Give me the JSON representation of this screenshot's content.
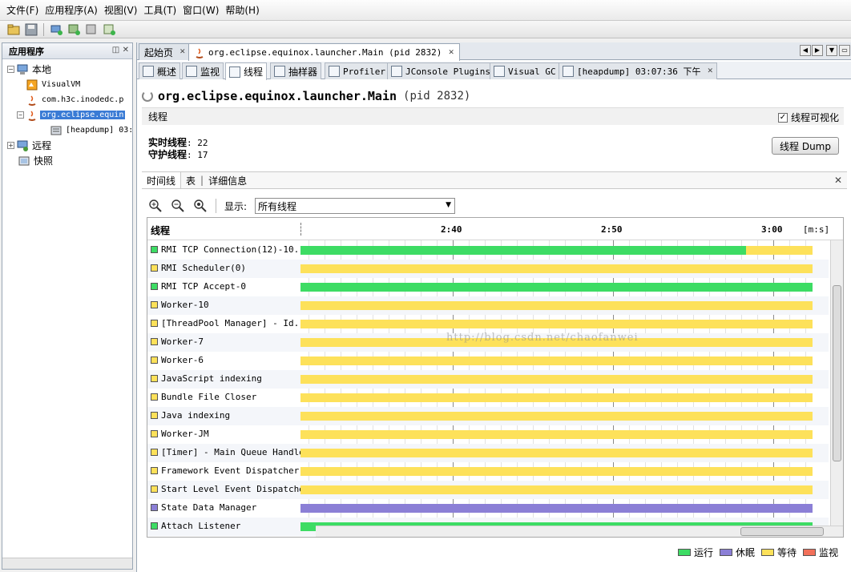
{
  "menu": [
    "文件(F)",
    "应用程序(A)",
    "视图(V)",
    "工具(T)",
    "窗口(W)",
    "帮助(H)"
  ],
  "toolbar": {
    "icons": [
      "open-icon",
      "save-icon",
      "add-host-icon",
      "add-jmx-icon",
      "add-coredump-icon",
      "add-snapshot-icon"
    ]
  },
  "left_panel": {
    "title": "应用程序",
    "tree": {
      "local": "本地",
      "visualvm": "VisualVM",
      "inode": "com.h3c.inodedc.p",
      "equinox": "org.eclipse.equin",
      "heapdump": "[heapdump] 03:",
      "remote": "远程",
      "snapshot": "快照"
    }
  },
  "doc_tabs": {
    "start": "起始页",
    "main": "org.eclipse.equinox.launcher.Main (pid 2832)"
  },
  "sub_tabs": {
    "overview": "概述",
    "monitor": "监视",
    "threads": "线程",
    "sampler": "抽样器",
    "profiler": "Profiler",
    "jconsole": "JConsole Plugins",
    "visualgc": "Visual GC",
    "heapdump": "[heapdump] 03:07:36 下午"
  },
  "page": {
    "title": "org.eclipse.equinox.launcher.Main",
    "pid": "(pid 2832)",
    "section": "线程",
    "visualize_label": "线程可视化",
    "live_label": "实时线程",
    "live_value": ": 22",
    "daemon_label": "守护线程",
    "daemon_value": ": 17",
    "dump_button": "线程 Dump"
  },
  "view_tabs": {
    "timeline": "时间线",
    "table": "表",
    "details": "详细信息",
    "sep": "|"
  },
  "zoom": {
    "display_label": "显示:",
    "selected": "所有线程"
  },
  "timeline": {
    "name_header": "线程",
    "ticks": [
      "2:40",
      "2:50",
      "3:00"
    ],
    "unit": "[m:s]",
    "watermark": "http://blog.csdn.net/chaofanwei"
  },
  "colors": {
    "running": "#3ddc64",
    "sleeping": "#8b7fd6",
    "waiting": "#fde15a",
    "monitor": "#f2705a"
  },
  "threads": [
    {
      "name": "RMI TCP Connection(12)-10...",
      "state": "running",
      "running_fraction": 0.87
    },
    {
      "name": "RMI Scheduler(0)",
      "state": "waiting"
    },
    {
      "name": "RMI TCP Accept-0",
      "state": "running"
    },
    {
      "name": "Worker-10",
      "state": "waiting"
    },
    {
      "name": "[ThreadPool Manager] - Id...",
      "state": "waiting"
    },
    {
      "name": "Worker-7",
      "state": "waiting"
    },
    {
      "name": "Worker-6",
      "state": "waiting"
    },
    {
      "name": "JavaScript indexing",
      "state": "waiting"
    },
    {
      "name": "Bundle File Closer",
      "state": "waiting"
    },
    {
      "name": "Java indexing",
      "state": "waiting"
    },
    {
      "name": "Worker-JM",
      "state": "waiting"
    },
    {
      "name": "[Timer] - Main Queue Handler",
      "state": "waiting"
    },
    {
      "name": "Framework Event Dispatcher",
      "state": "waiting"
    },
    {
      "name": "Start Level Event Dispatcher",
      "state": "waiting"
    },
    {
      "name": "State Data Manager",
      "state": "sleeping"
    },
    {
      "name": "Attach Listener",
      "state": "running"
    }
  ],
  "legend": [
    {
      "key": "running",
      "label": "运行"
    },
    {
      "key": "sleeping",
      "label": "休眠"
    },
    {
      "key": "waiting",
      "label": "等待"
    },
    {
      "key": "monitor",
      "label": "监视"
    }
  ]
}
